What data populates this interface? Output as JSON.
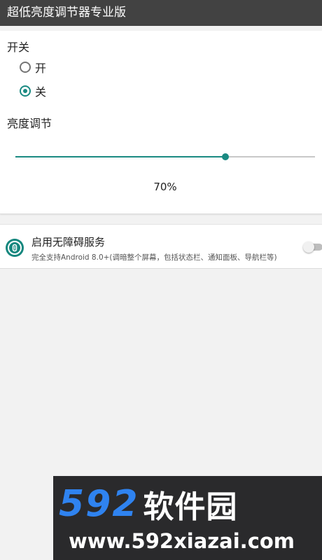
{
  "app_bar": {
    "title": "超低亮度调节器专业版"
  },
  "switch_section": {
    "title": "开关",
    "options": [
      {
        "label": "开",
        "checked": false
      },
      {
        "label": "关",
        "checked": true
      }
    ]
  },
  "brightness_section": {
    "title": "亮度调节",
    "value": 70,
    "value_label": "70%"
  },
  "accessibility_service": {
    "title": "启用无障碍服务",
    "description": "完全支持Android 8.0+(调暗整个屏幕，包括状态栏、通知面板、导航栏等)",
    "enabled": false,
    "icon": "accessibility-icon"
  },
  "watermark": {
    "brand_number": "592",
    "brand_text": "软件园",
    "url": "www.592xiazai.com"
  },
  "colors": {
    "accent": "#1a8a82",
    "app_bar": "#424242",
    "watermark_blue": "#2f83f0"
  }
}
